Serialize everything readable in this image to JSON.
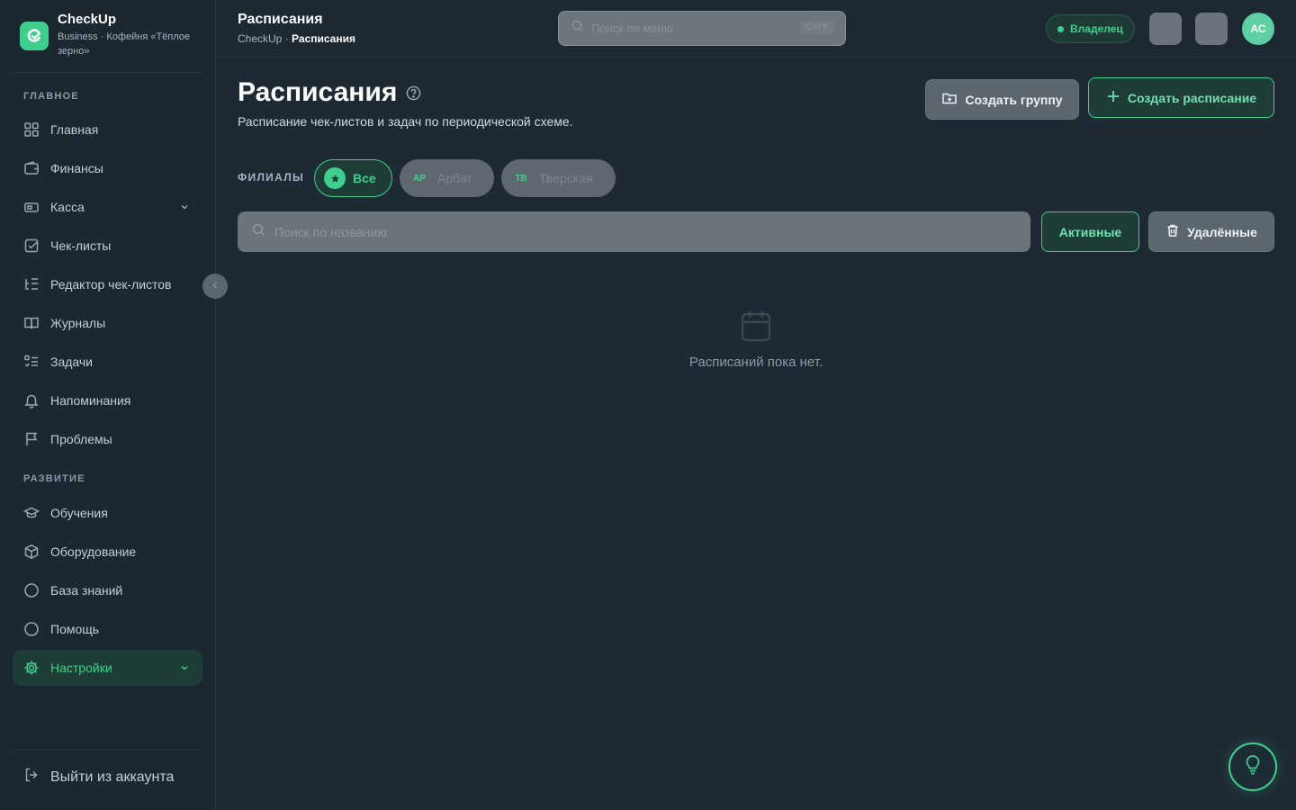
{
  "brand": {
    "name": "CheckUp",
    "subtitle": "Business · Кофейня «Тёплое зерно»"
  },
  "sidebar": {
    "sections": [
      {
        "label": "ГЛАВНОЕ"
      },
      {
        "label": "РАЗВИТИЕ"
      }
    ],
    "items": [
      {
        "label": "Главная",
        "icon": "dashboard-icon"
      },
      {
        "label": "Финансы",
        "icon": "wallet-icon"
      },
      {
        "label": "Касса",
        "icon": "cash-register-icon"
      },
      {
        "label": "Чек-листы",
        "icon": "checkbox-icon"
      },
      {
        "label": "Редактор чек-листов",
        "icon": "list-tree-icon"
      },
      {
        "label": "Журналы",
        "icon": "book-icon"
      },
      {
        "label": "Задачи",
        "icon": "tasks-icon"
      },
      {
        "label": "Напоминания",
        "icon": "bell-icon"
      },
      {
        "label": "Проблемы",
        "icon": "flag-icon"
      },
      {
        "label": "Обучения",
        "icon": "graduation-cap-icon"
      },
      {
        "label": "Оборудование",
        "icon": "box-icon"
      },
      {
        "label": "База знаний",
        "icon": "circle-icon"
      },
      {
        "label": "Помощь",
        "icon": "circle-icon"
      },
      {
        "label": "Настройки",
        "icon": "gear-icon"
      }
    ],
    "logout_label": "Выйти из аккаунта"
  },
  "topbar": {
    "title": "Расписания",
    "breadcrumb_root": "CheckUp",
    "breadcrumb_current": "Расписания",
    "search_placeholder": "Поиск по меню",
    "search_shortcut": "Ctrl K",
    "role": "Владелец",
    "avatar_initials": "АС"
  },
  "main": {
    "title": "Расписания",
    "subtitle": "Расписание чек-листов и задач по периодической схеме.",
    "create_group_label": "Создать группу",
    "create_schedule_label": "Создать расписание",
    "filters_label": "ФИЛИАЛЫ",
    "branches": [
      {
        "abbr": "",
        "label": "Все",
        "selected": true
      },
      {
        "abbr": "АР",
        "label": "Арбат",
        "selected": false
      },
      {
        "abbr": "ТВ",
        "label": "Тверская",
        "selected": false
      }
    ],
    "search_placeholder": "Поиск по названию",
    "active_tab_label": "Активные",
    "deleted_tab_label": "Удалённые",
    "empty_text": "Расписаний пока нет."
  },
  "colors": {
    "accent": "#3ecf8e",
    "background": "#1d2a34",
    "sidebar": "#1b2731"
  }
}
